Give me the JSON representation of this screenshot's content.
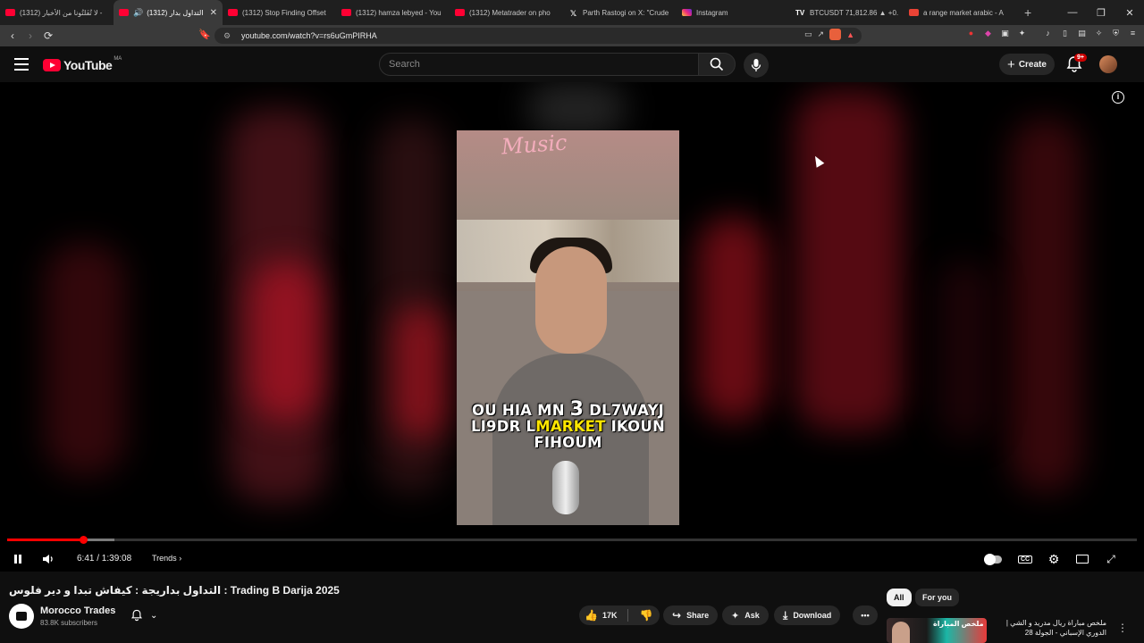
{
  "browser": {
    "tabs": [
      {
        "title": "(1312) لا تُفَلْتُونا من الأخبار -",
        "icon": "youtube-icon"
      },
      {
        "title": "(1312) التداول بدار",
        "icon": "youtube-icon",
        "active": true
      },
      {
        "title": "(1312) Stop Finding Offset",
        "icon": "youtube-icon"
      },
      {
        "title": "(1312) hamza lebyed - You",
        "icon": "youtube-icon"
      },
      {
        "title": "(1312) Metatrader on pho",
        "icon": "youtube-icon"
      },
      {
        "title": "Parth Rastogi on X: \"Crude",
        "icon": "x-icon"
      },
      {
        "title": "Instagram",
        "icon": "instagram-icon"
      },
      {
        "title": "BTCUSDT 71,812.86 ▲ +0.",
        "icon": "tradingview-icon"
      },
      {
        "title": "a range market arabic - A",
        "icon": "google-icon"
      }
    ],
    "url": "youtube.com/watch?v=rs6uGmPIRHA"
  },
  "youtube": {
    "logo_text": "YouTube",
    "region": "MA",
    "search_placeholder": "Search",
    "create_label": "Create",
    "notif_badge": "9+"
  },
  "player": {
    "caption_line1a": "OU HIA MN ",
    "caption_line1b": "3",
    "caption_line1c": " DL7WAYJ",
    "caption_line2a": "LI9DR L",
    "caption_line2b": "MARKET",
    "caption_line2c": " IKOUN",
    "caption_line3": "FIHOUM",
    "neon_sign": "Music",
    "current_time": "6:41 / 1:39:08",
    "chapter": "Trends",
    "progress_fraction": 0.067,
    "buffered_fraction": 0.095
  },
  "video": {
    "title": "التداول بداريجة : كيفاش تبدا و دير فلوس : Trading B Darija 2025",
    "channel": "Morocco Trades",
    "subscribers": "83.8K subscribers",
    "likes": "17K",
    "share_label": "Share",
    "ask_label": "Ask",
    "download_label": "Download"
  },
  "sidebar": {
    "chip_all": "All",
    "chip_foryou": "For you",
    "rec_title": "ملخص مباراة ريال مدريد و الشي | الدوري الإسباني - الجولة 28",
    "rec_thumb_text": "ملخص المباراة"
  },
  "colors": {
    "accent_red": "#ff0033",
    "progress_red": "#ff0000",
    "caption_yellow": "#ffe600"
  }
}
